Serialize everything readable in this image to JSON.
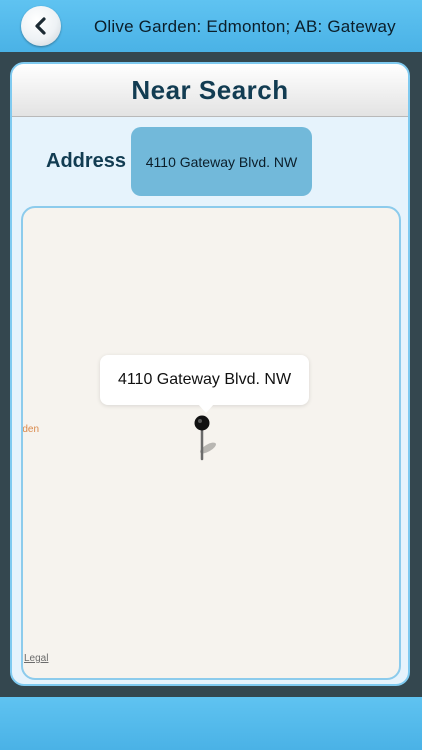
{
  "navbar": {
    "back_icon": "chevron-left-icon",
    "title": "Olive Garden: Edmonton; AB: Gateway"
  },
  "card": {
    "title": "Near Search",
    "address_label": "Address",
    "address_value": "4110 Gateway Blvd. NW"
  },
  "map": {
    "place_label": "rden",
    "callout_text": "4110 Gateway Blvd. NW",
    "pin_icon": "map-pin-icon",
    "legal_link": "Legal"
  },
  "colors": {
    "bar_blue": "#4ab2e6",
    "title_navy": "#123c52",
    "address_box": "#72b9da",
    "map_background": "#f6f3ee"
  }
}
